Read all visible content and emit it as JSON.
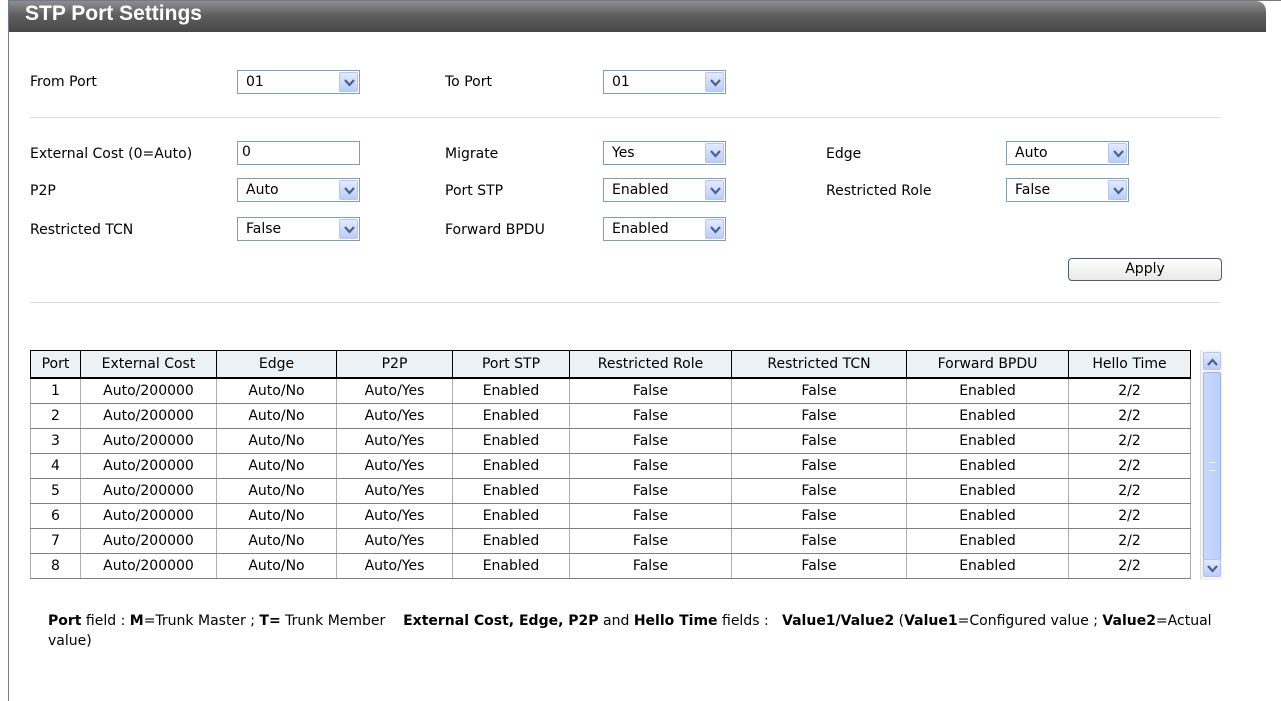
{
  "title": "STP Port Settings",
  "from_port": {
    "label": "From Port",
    "value": "01"
  },
  "to_port": {
    "label": "To Port",
    "value": "01"
  },
  "external_cost": {
    "label": "External Cost (0=Auto)",
    "value": "0"
  },
  "migrate": {
    "label": "Migrate",
    "value": "Yes"
  },
  "edge": {
    "label": "Edge",
    "value": "Auto"
  },
  "p2p": {
    "label": "P2P",
    "value": "Auto"
  },
  "port_stp": {
    "label": "Port STP",
    "value": "Enabled"
  },
  "restricted_role": {
    "label": "Restricted Role",
    "value": "False"
  },
  "restricted_tcn": {
    "label": "Restricted TCN",
    "value": "False"
  },
  "forward_bpdu": {
    "label": "Forward BPDU",
    "value": "Enabled"
  },
  "apply_label": "Apply",
  "table": {
    "headers": [
      "Port",
      "External Cost",
      "Edge",
      "P2P",
      "Port STP",
      "Restricted Role",
      "Restricted TCN",
      "Forward BPDU",
      "Hello Time"
    ],
    "rows": [
      [
        "1",
        "Auto/200000",
        "Auto/No",
        "Auto/Yes",
        "Enabled",
        "False",
        "False",
        "Enabled",
        "2/2"
      ],
      [
        "2",
        "Auto/200000",
        "Auto/No",
        "Auto/Yes",
        "Enabled",
        "False",
        "False",
        "Enabled",
        "2/2"
      ],
      [
        "3",
        "Auto/200000",
        "Auto/No",
        "Auto/Yes",
        "Enabled",
        "False",
        "False",
        "Enabled",
        "2/2"
      ],
      [
        "4",
        "Auto/200000",
        "Auto/No",
        "Auto/Yes",
        "Enabled",
        "False",
        "False",
        "Enabled",
        "2/2"
      ],
      [
        "5",
        "Auto/200000",
        "Auto/No",
        "Auto/Yes",
        "Enabled",
        "False",
        "False",
        "Enabled",
        "2/2"
      ],
      [
        "6",
        "Auto/200000",
        "Auto/No",
        "Auto/Yes",
        "Enabled",
        "False",
        "False",
        "Enabled",
        "2/2"
      ],
      [
        "7",
        "Auto/200000",
        "Auto/No",
        "Auto/Yes",
        "Enabled",
        "False",
        "False",
        "Enabled",
        "2/2"
      ],
      [
        "8",
        "Auto/200000",
        "Auto/No",
        "Auto/Yes",
        "Enabled",
        "False",
        "False",
        "Enabled",
        "2/2"
      ]
    ]
  },
  "legend": {
    "port_b": "Port",
    "port_text": " field : ",
    "m_b": "M",
    "m_text": "=Trunk Master ; ",
    "t_b": "T=",
    "t_text": " Trunk Member",
    "fields_b": "External Cost, Edge, P2P",
    "and_text": " and ",
    "hello_b": "Hello Time",
    "fields_text": " fields : ",
    "v12_b": "Value1/Value2",
    "open_text": " (",
    "v1_b": "Value1",
    "configured_text": "=Configured value ; ",
    "v2_b": "Value2",
    "actual_text": "=Actual value)"
  },
  "colors": {
    "titlebar": "#5f5f5f",
    "header_bg": "#ecf1f6",
    "dropdown_button": "#c4d5fc",
    "border": "#7f9db9"
  },
  "icons": {
    "dropdown": "chevron-down-icon",
    "scroll_up": "chevron-up-icon",
    "scroll_down": "chevron-down-icon"
  }
}
